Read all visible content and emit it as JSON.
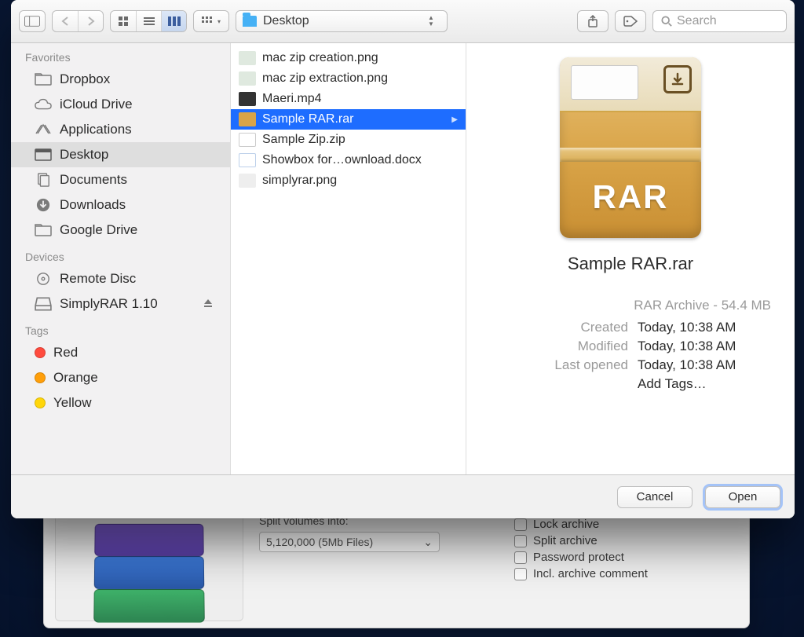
{
  "toolbar": {
    "location_label": "Desktop",
    "search_placeholder": "Search"
  },
  "sidebar": {
    "sections": {
      "favorites": {
        "title": "Favorites",
        "items": [
          {
            "label": "Dropbox",
            "icon": "folder"
          },
          {
            "label": "iCloud Drive",
            "icon": "cloud"
          },
          {
            "label": "Applications",
            "icon": "apps"
          },
          {
            "label": "Desktop",
            "icon": "desktop",
            "selected": true
          },
          {
            "label": "Documents",
            "icon": "doc"
          },
          {
            "label": "Downloads",
            "icon": "download"
          },
          {
            "label": "Google Drive",
            "icon": "folder"
          }
        ]
      },
      "devices": {
        "title": "Devices",
        "items": [
          {
            "label": "Remote Disc",
            "icon": "disc"
          },
          {
            "label": "SimplyRAR 1.10",
            "icon": "drive",
            "ejectable": true
          }
        ]
      },
      "tags": {
        "title": "Tags",
        "items": [
          {
            "label": "Red",
            "color": "red"
          },
          {
            "label": "Orange",
            "color": "orange"
          },
          {
            "label": "Yellow",
            "color": "yellow"
          }
        ]
      }
    }
  },
  "files": [
    {
      "name": "mac zip creation.png",
      "kind": "image"
    },
    {
      "name": "mac zip extraction.png",
      "kind": "image"
    },
    {
      "name": "Maeri.mp4",
      "kind": "video"
    },
    {
      "name": "Sample RAR.rar",
      "kind": "archive",
      "selected": true
    },
    {
      "name": "Sample Zip.zip",
      "kind": "archive"
    },
    {
      "name": "Showbox for…ownload.docx",
      "kind": "doc"
    },
    {
      "name": "simplyrar.png",
      "kind": "image"
    }
  ],
  "preview": {
    "badge_text": "RAR",
    "filename": "Sample RAR.rar",
    "type_line": "RAR Archive - 54.4 MB",
    "rows": {
      "created": {
        "k": "Created",
        "v": "Today, 10:38 AM"
      },
      "modified": {
        "k": "Modified",
        "v": "Today, 10:38 AM"
      },
      "last_opened": {
        "k": "Last opened",
        "v": "Today, 10:38 AM"
      }
    },
    "add_tags": "Add Tags…"
  },
  "buttons": {
    "cancel": "Cancel",
    "open": "Open"
  },
  "behind": {
    "split_label": "Split volumes into:",
    "split_value": "5,120,000 (5Mb Files)",
    "checks": {
      "lock": "Lock archive",
      "split": "Split archive",
      "pass": "Password protect",
      "comment": "Incl. archive comment"
    }
  }
}
